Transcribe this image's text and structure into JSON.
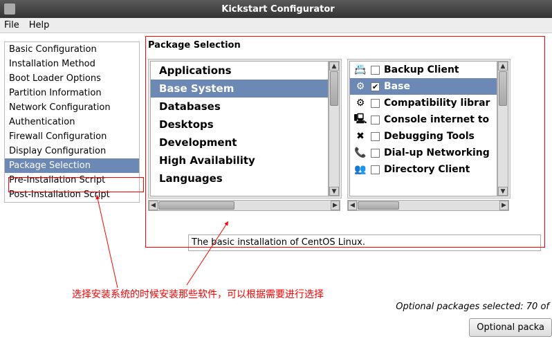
{
  "window": {
    "title": "Kickstart Configurator"
  },
  "menubar": {
    "file": "File",
    "help": "Help"
  },
  "sidebar": {
    "items": [
      "Basic Configuration",
      "Installation Method",
      "Boot Loader Options",
      "Partition Information",
      "Network Configuration",
      "Authentication",
      "Firewall Configuration",
      "Display Configuration",
      "Package Selection",
      "Pre-Installation Script",
      "Post-Installation Script"
    ],
    "selected_index": 8
  },
  "panel": {
    "title": "Package Selection",
    "categories": [
      "Applications",
      "Base System",
      "Databases",
      "Desktops",
      "Development",
      "High Availability",
      "Languages"
    ],
    "categories_selected_index": 1,
    "packages": [
      {
        "icon": "📇",
        "checked": false,
        "label": "Backup Client"
      },
      {
        "icon": "⚙",
        "checked": true,
        "label": "Base"
      },
      {
        "icon": "⚙",
        "checked": false,
        "label": "Compatibility librar"
      },
      {
        "icon": "🖳",
        "checked": false,
        "label": "Console internet to"
      },
      {
        "icon": "✖",
        "checked": false,
        "label": "Debugging Tools"
      },
      {
        "icon": "📞",
        "checked": false,
        "label": "Dial-up Networking"
      },
      {
        "icon": "👥",
        "checked": false,
        "label": "Directory Client"
      }
    ],
    "packages_selected_index": 1,
    "description": "The basic installation of CentOS Linux.",
    "status": "Optional packages selected: 70 of",
    "optional_button": "Optional packa"
  },
  "annotation": "选择安装系统的时候安装那些软件，可以根据需要进行选择"
}
